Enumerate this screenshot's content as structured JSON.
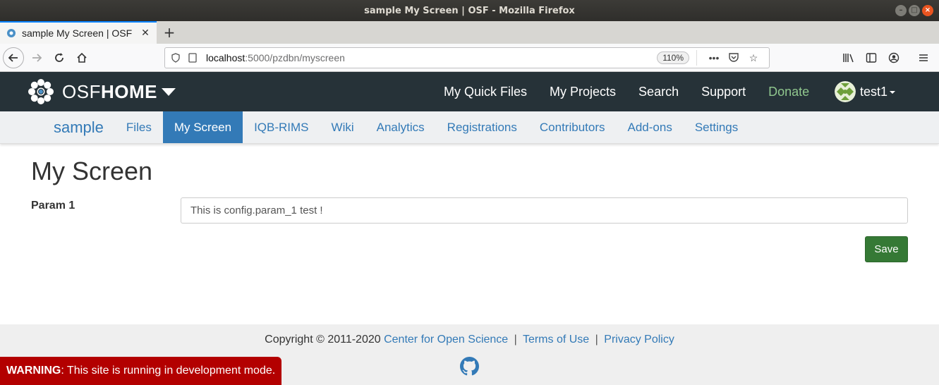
{
  "window": {
    "title": "sample My Screen | OSF - Mozilla Firefox"
  },
  "tabs": [
    {
      "title": "sample My Screen | OSF",
      "icon": "osf-favicon"
    }
  ],
  "urlbar": {
    "host": "localhost",
    "path": ":5000/pzdbn/myscreen",
    "zoom": "110%"
  },
  "osf": {
    "brand_light": "OSF",
    "brand_bold": "HOME",
    "nav": {
      "quick_files": "My Quick Files",
      "projects": "My Projects",
      "search": "Search",
      "support": "Support",
      "donate": "Donate"
    },
    "user": "test1"
  },
  "project_nav": {
    "title": "sample",
    "items": [
      "Files",
      "My Screen",
      "IQB-RIMS",
      "Wiki",
      "Analytics",
      "Registrations",
      "Contributors",
      "Add-ons",
      "Settings"
    ],
    "active": "My Screen"
  },
  "main": {
    "title": "My Screen",
    "param_label": "Param 1",
    "param_value": "This is config.param_1 test !",
    "save_label": "Save"
  },
  "footer": {
    "copyright": "Copyright © 2011-2020",
    "cos_link": "Center for Open Science",
    "terms_link": "Terms of Use",
    "privacy_link": "Privacy Policy",
    "separator": "|"
  },
  "warning": {
    "label": "WARNING",
    "message": ": This site is running in development mode."
  },
  "colors": {
    "osf_header": "#263238",
    "link_blue": "#337ab7",
    "save_green": "#357935",
    "donate_green": "#90c78e",
    "warning_red": "#b30000"
  }
}
